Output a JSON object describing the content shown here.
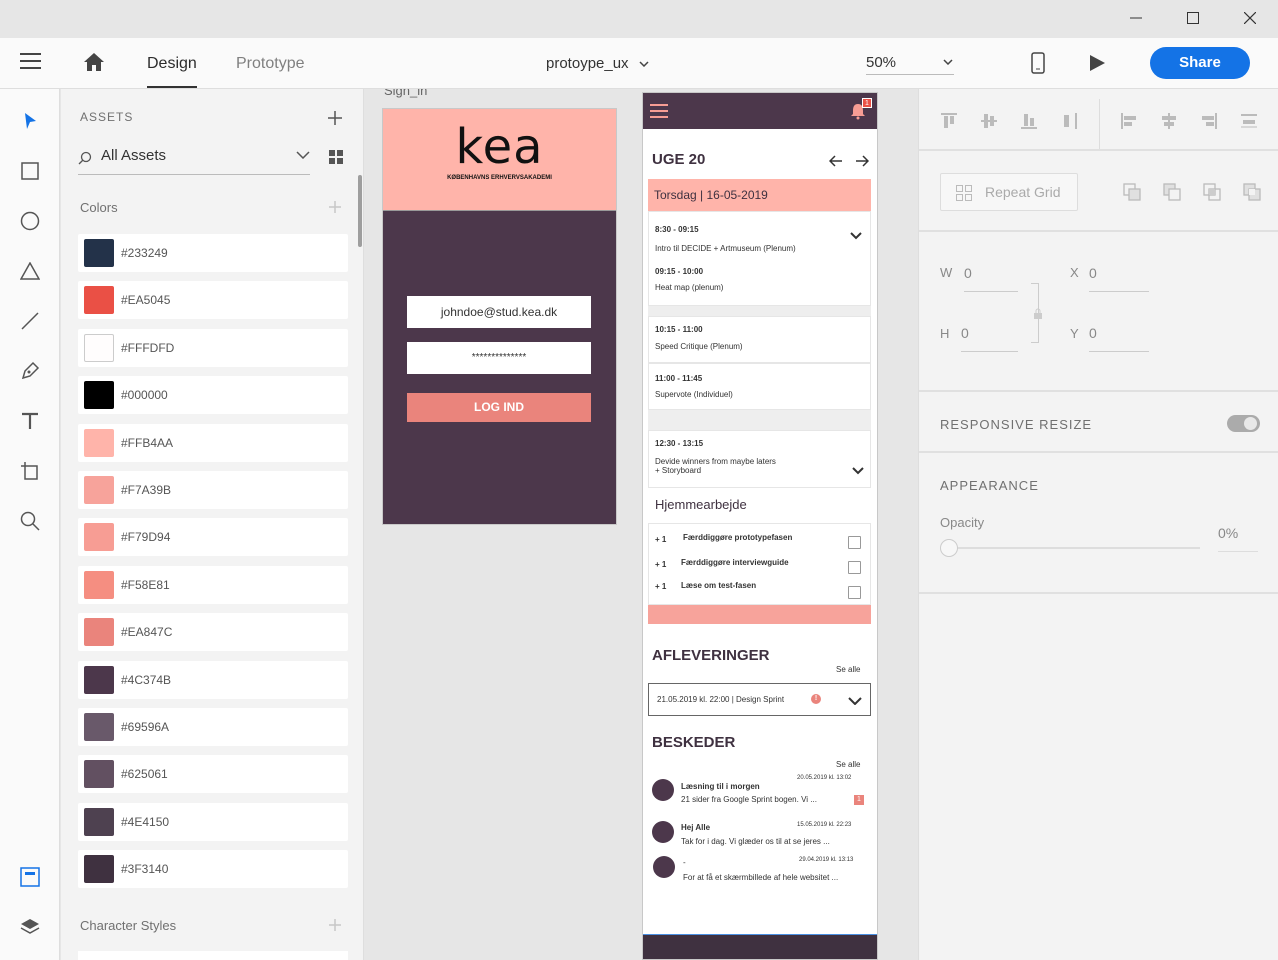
{
  "window": {
    "minimize_icon": "minimize-icon",
    "maximize_icon": "maximize-icon",
    "close_icon": "close-icon"
  },
  "appbar": {
    "tabs": [
      {
        "label": "Design"
      },
      {
        "label": "Prototype"
      }
    ],
    "document_title": "protoype_ux",
    "zoom": "50%",
    "share_label": "Share"
  },
  "assets": {
    "heading": "ASSETS",
    "filter_label": "All Assets",
    "colors_heading": "Colors",
    "character_styles_heading": "Character Styles",
    "colors": [
      {
        "hex": "#233249",
        "color": "#233249"
      },
      {
        "hex": "#EA5045",
        "color": "#EA5045"
      },
      {
        "hex": "#FFFDFD",
        "color": "#FFFDFD"
      },
      {
        "hex": "#000000",
        "color": "#000000"
      },
      {
        "hex": "#FFB4AA",
        "color": "#FFB4AA"
      },
      {
        "hex": "#F7A39B",
        "color": "#F7A39B"
      },
      {
        "hex": "#F79D94",
        "color": "#F79D94"
      },
      {
        "hex": "#F58E81",
        "color": "#F58E81"
      },
      {
        "hex": "#EA847C",
        "color": "#EA847C"
      },
      {
        "hex": "#4C374B",
        "color": "#4C374B"
      },
      {
        "hex": "#69596A",
        "color": "#69596A"
      },
      {
        "hex": "#625061",
        "color": "#625061"
      },
      {
        "hex": "#4E4150",
        "color": "#4E4150"
      },
      {
        "hex": "#3F3140",
        "color": "#3F3140"
      }
    ]
  },
  "signin": {
    "artboard_label": "Sign_in",
    "logo_text": "kea",
    "logo_subtitle": "KØBENHAVNS ERHVERVSAKADEMI",
    "email_value": "johndoe@stud.kea.dk",
    "password_value": "**************",
    "login_label": "LOG IND"
  },
  "dashboard": {
    "notification_count": "1",
    "week_label": "UGE 20",
    "day_label": "Torsdag | 16-05-2019",
    "schedule": [
      {
        "time": "8:30 - 09:15",
        "title": "Intro til DECIDE + Artmuseum (Plenum)"
      },
      {
        "time": "09:15 - 10:00",
        "title": "Heat map (plenum)"
      },
      {
        "time": "10:15 - 11:00",
        "title": "Speed Critique (Plenum)"
      },
      {
        "time": "11:00 - 11:45",
        "title": "Supervote (Individuel)"
      },
      {
        "time": "12:30 - 13:15",
        "title": "Devide winners from maybe laters",
        "title2": "+ Storyboard"
      }
    ],
    "homework_heading": "Hjemmearbejde",
    "homework": [
      {
        "count": "+ 1",
        "label": "Færddiggøre prototypefasen"
      },
      {
        "count": "+ 1",
        "label": "Færddiggøre interviewguide"
      },
      {
        "count": "+ 1",
        "label": "Læse om test-fasen"
      }
    ],
    "deliveries_heading": "AFLEVERINGER",
    "deliveries_see_all": "Se alle",
    "delivery_item": "21.05.2019 kl. 22:00 | Design Sprint",
    "messages_heading": "BESKEDER",
    "messages_see_all": "Se alle",
    "messages": [
      {
        "sender": "Læsning til i morgen",
        "date": "20.05.2019 kl. 13:02",
        "preview": "21 sider fra Google Sprint bogen. Vi ..."
      },
      {
        "sender": "Hej Alle",
        "date": "15.05.2019 kl. 22:23",
        "preview": "Tak for i dag. Vi glæder os til at se jeres ..."
      },
      {
        "sender": "-",
        "date": "29.04.2019 kl. 13:13",
        "preview": "For at få et skærmbillede af hele websitet ..."
      }
    ]
  },
  "properties": {
    "repeat_grid_label": "Repeat Grid",
    "w_label": "W",
    "w_value": "0",
    "h_label": "H",
    "h_value": "0",
    "x_label": "X",
    "x_value": "0",
    "y_label": "Y",
    "y_value": "0",
    "responsive_resize_label": "RESPONSIVE RESIZE",
    "appearance_label": "APPEARANCE",
    "opacity_label": "Opacity",
    "opacity_value": "0%"
  }
}
